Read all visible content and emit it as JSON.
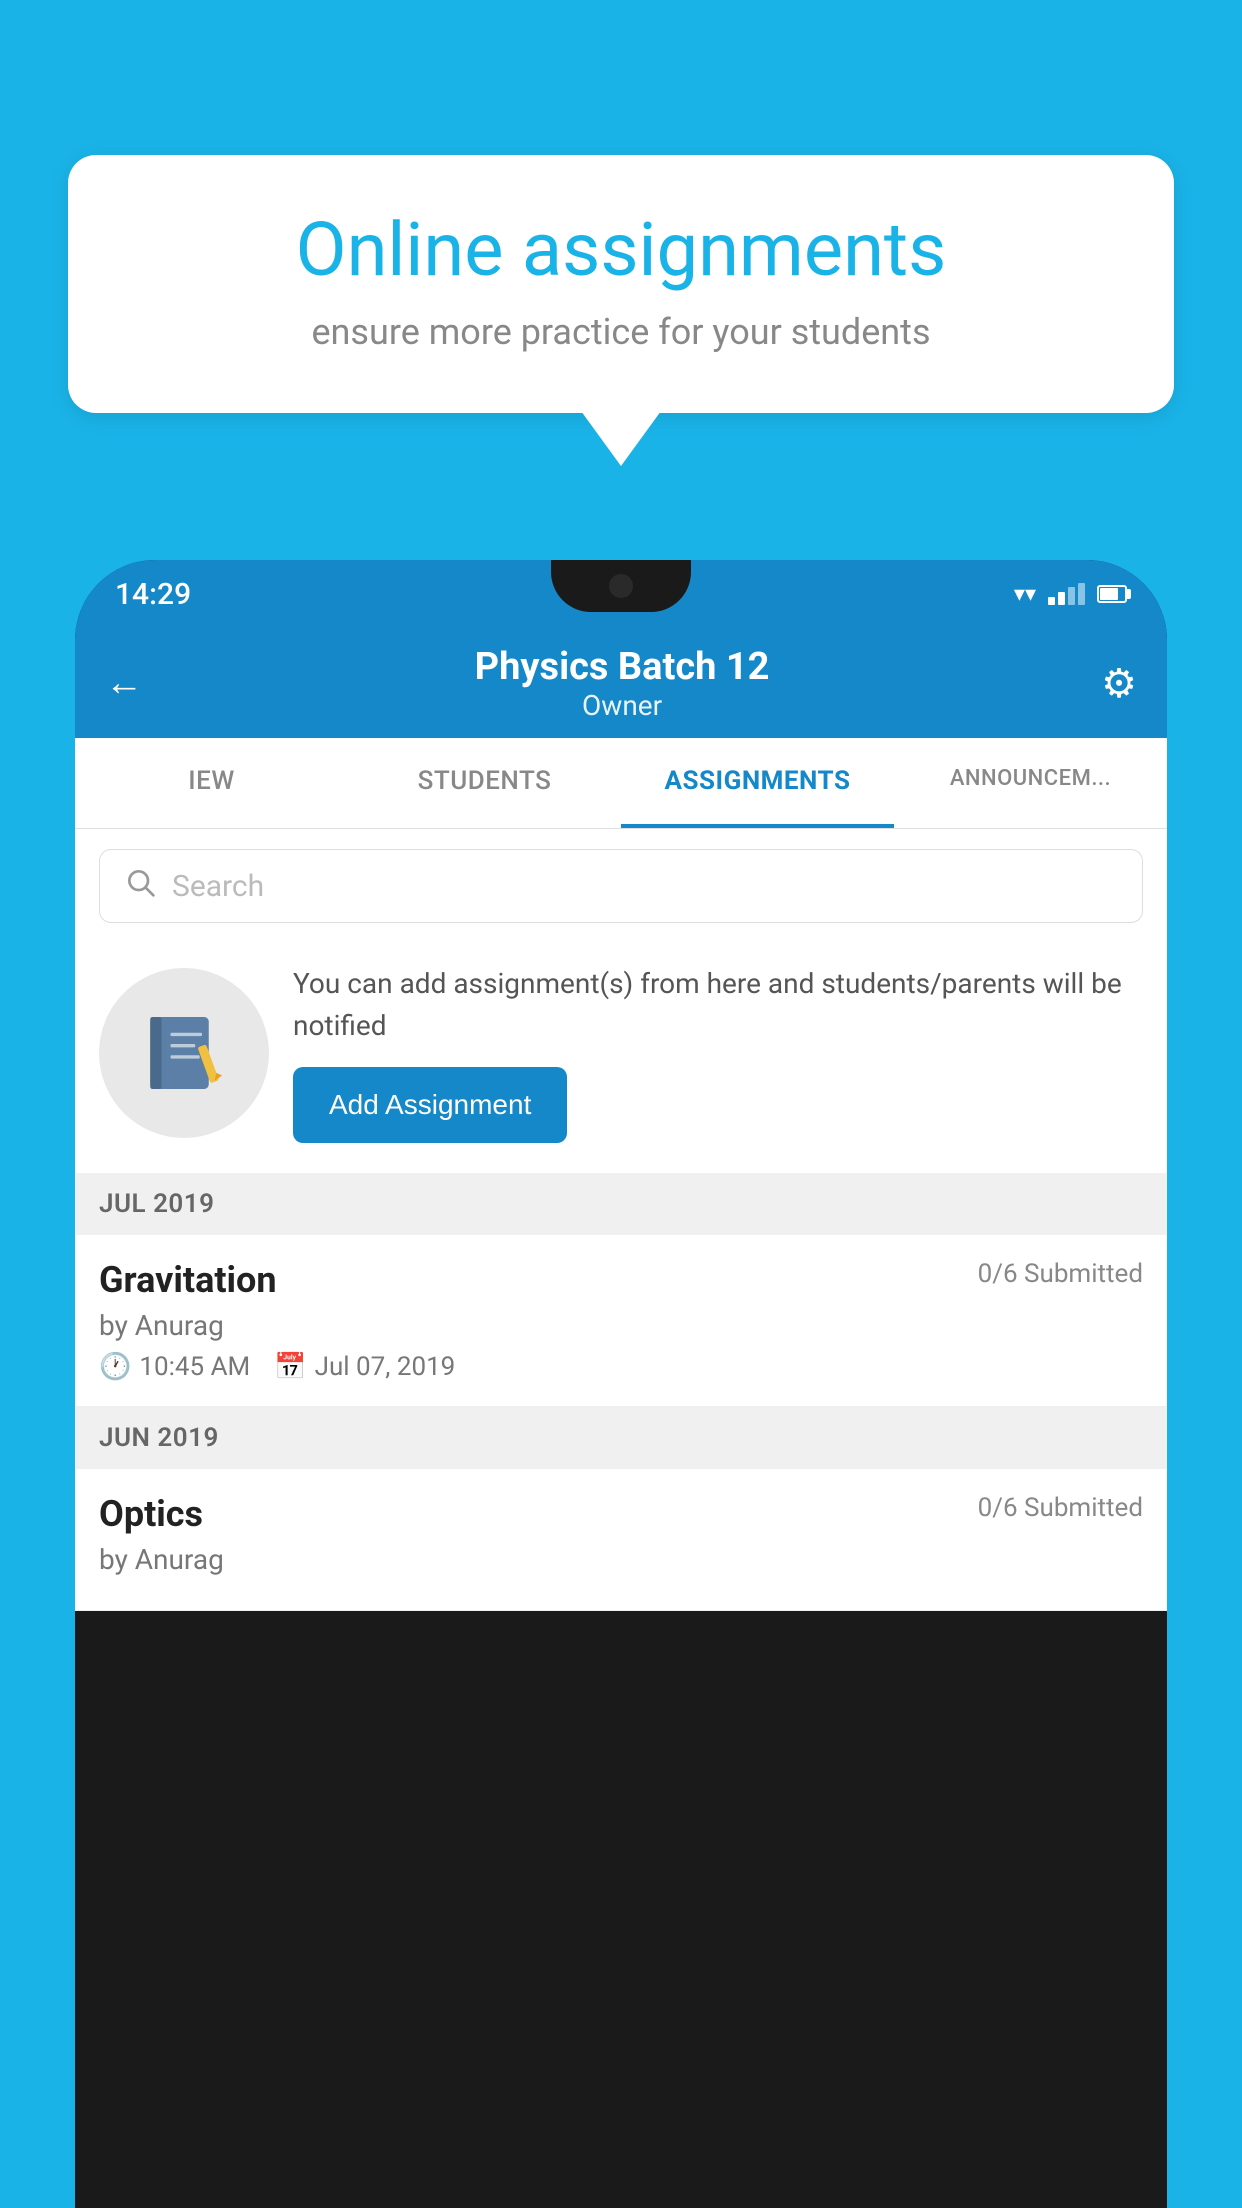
{
  "background_color": "#1ab3e8",
  "speech_bubble": {
    "title": "Online assignments",
    "subtitle": "ensure more practice for your students"
  },
  "status_bar": {
    "time": "14:29"
  },
  "header": {
    "title": "Physics Batch 12",
    "subtitle": "Owner",
    "back_label": "←",
    "settings_label": "⚙"
  },
  "tabs": [
    {
      "label": "IEW",
      "active": false
    },
    {
      "label": "STUDENTS",
      "active": false
    },
    {
      "label": "ASSIGNMENTS",
      "active": true
    },
    {
      "label": "ANNOUNCEM...",
      "active": false
    }
  ],
  "search": {
    "placeholder": "Search"
  },
  "info_card": {
    "text": "You can add assignment(s) from here and students/parents will be notified",
    "button_label": "Add Assignment"
  },
  "sections": [
    {
      "month": "JUL 2019",
      "assignments": [
        {
          "name": "Gravitation",
          "submitted": "0/6 Submitted",
          "by": "by Anurag",
          "time": "10:45 AM",
          "date": "Jul 07, 2019"
        }
      ]
    },
    {
      "month": "JUN 2019",
      "assignments": [
        {
          "name": "Optics",
          "submitted": "0/6 Submitted",
          "by": "by Anurag",
          "time": "",
          "date": ""
        }
      ]
    }
  ]
}
